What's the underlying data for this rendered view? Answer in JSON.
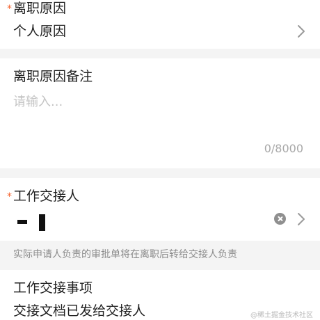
{
  "reason": {
    "label": "离职原因",
    "required_mark": "*",
    "value": "个人原因"
  },
  "reason_note": {
    "label": "离职原因备注",
    "placeholder": "请输入...",
    "value": "",
    "counter": "0/8000"
  },
  "handover_person": {
    "label": "工作交接人",
    "required_mark": "*",
    "value_redacted": true
  },
  "hint": "实际申请人负责的审批单将在离职后转给交接人负责",
  "handover_items": {
    "label": "工作交接事项",
    "value": "交接文档已发给交接人"
  },
  "watermark": "@稀土掘金技术社区",
  "colors": {
    "required": "#f5612b",
    "placeholder": "#c4c4c4",
    "hint": "#8a8a8a",
    "background": "#f4f4f4"
  },
  "icons": {
    "chevron": "chevron-right-icon",
    "clear": "clear-circle-icon"
  }
}
